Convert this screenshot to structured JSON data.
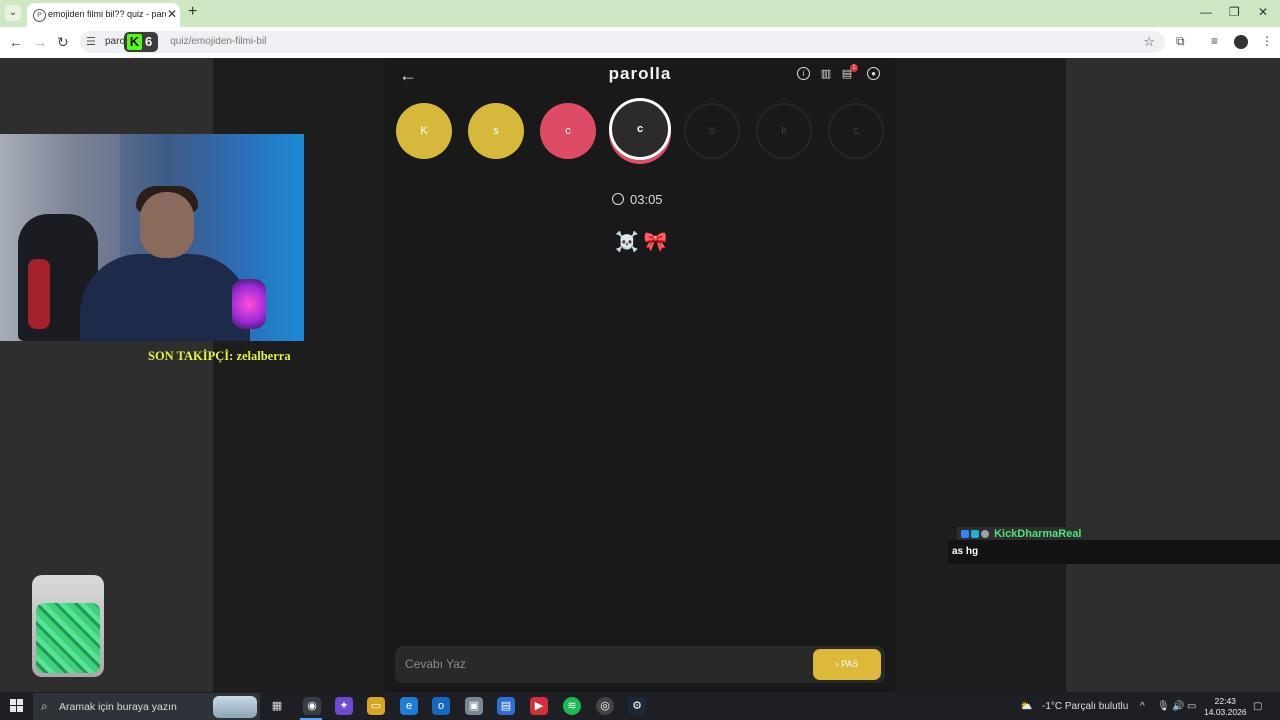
{
  "browser": {
    "tab_title": "emojiden filmi bil?? quiz - parolla",
    "url_host": "parol",
    "url_path": "quiz/emojiden-filmi-bil",
    "kick_count": "6"
  },
  "parolla": {
    "title": "parolla",
    "notification_count": "1",
    "letters": [
      {
        "letter": "K",
        "state": "correct"
      },
      {
        "letter": "s",
        "state": "correct"
      },
      {
        "letter": "c",
        "state": "wrong"
      },
      {
        "letter": "c",
        "state": "active"
      },
      {
        "letter": "ö",
        "state": "pending"
      },
      {
        "letter": "k",
        "state": "pending"
      },
      {
        "letter": "c",
        "state": "pending"
      }
    ],
    "timer": "03:05",
    "emoji_clue": "☠️ 🎀",
    "answer_placeholder": "Cevabı Yaz",
    "pass_label": "PAS",
    "colors": {
      "correct": "#d6b83b",
      "wrong": "#dd4c64",
      "pass": "#dcb83b"
    }
  },
  "stream": {
    "last_follower": "SON TAKİPÇİ: zelalberra",
    "chat": {
      "username": "KickDharmaReal",
      "message": "as hg"
    }
  },
  "taskbar": {
    "search_placeholder": "Aramak için buraya yazın",
    "weather": "-1°C  Parçalı bulutlu",
    "time": "22:43",
    "date": "14.03.2026"
  }
}
